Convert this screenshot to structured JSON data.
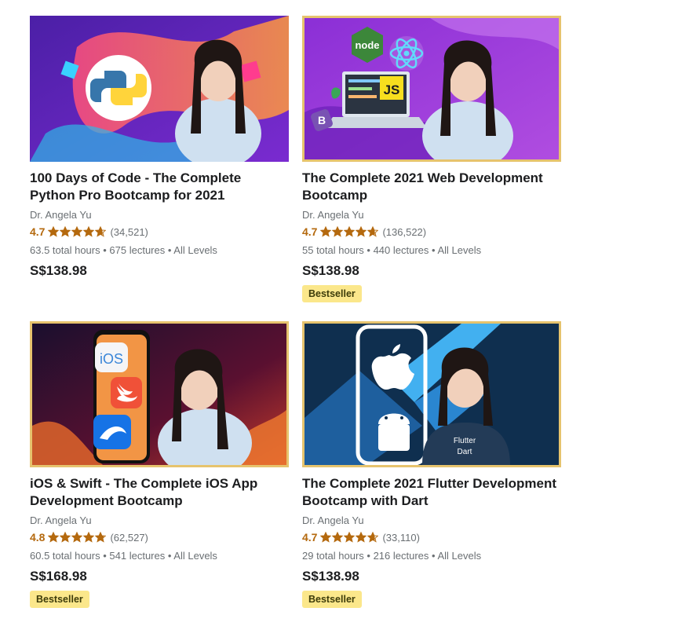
{
  "theme": {
    "rating_color": "#b4690e",
    "badge_bg": "#fbe78b",
    "gold_border": "#e6c36d"
  },
  "courses": [
    {
      "title": "100 Days of Code - The Complete Python Pro Bootcamp for 2021",
      "instructor": "Dr. Angela Yu",
      "rating": "4.7",
      "rating_value": 4.7,
      "reviews": "(34,521)",
      "hours": "63.5 total hours",
      "lectures": "675 lectures",
      "level": "All Levels",
      "price": "S$138.98",
      "badge": "",
      "thumbnail_icon": "python-logo-icon"
    },
    {
      "title": "The Complete 2021 Web Development Bootcamp",
      "instructor": "Dr. Angela Yu",
      "rating": "4.7",
      "rating_value": 4.7,
      "reviews": "(136,522)",
      "hours": "55 total hours",
      "lectures": "440 lectures",
      "level": "All Levels",
      "price": "S$138.98",
      "badge": "Bestseller",
      "thumbnail_icon": "web-dev-icons",
      "thumbnail_labels": {
        "node": "node",
        "js": "JS",
        "bootstrap": "B"
      }
    },
    {
      "title": "iOS & Swift - The Complete iOS App Development Bootcamp",
      "instructor": "Dr. Angela Yu",
      "rating": "4.8",
      "rating_value": 4.8,
      "reviews": "(62,527)",
      "hours": "60.5 total hours",
      "lectures": "541 lectures",
      "level": "All Levels",
      "price": "S$168.98",
      "badge": "Bestseller",
      "thumbnail_icon": "ios-swift-icons",
      "thumbnail_labels": {
        "ios": "iOS"
      }
    },
    {
      "title": "The Complete 2021 Flutter Development Bootcamp with Dart",
      "instructor": "Dr. Angela Yu",
      "rating": "4.7",
      "rating_value": 4.7,
      "reviews": "(33,110)",
      "hours": "29 total hours",
      "lectures": "216 lectures",
      "level": "All Levels",
      "price": "S$138.98",
      "badge": "Bestseller",
      "thumbnail_icon": "flutter-icons",
      "thumbnail_labels": {
        "shirt_line1": "Flutter",
        "shirt_line2": "Dart"
      }
    }
  ]
}
